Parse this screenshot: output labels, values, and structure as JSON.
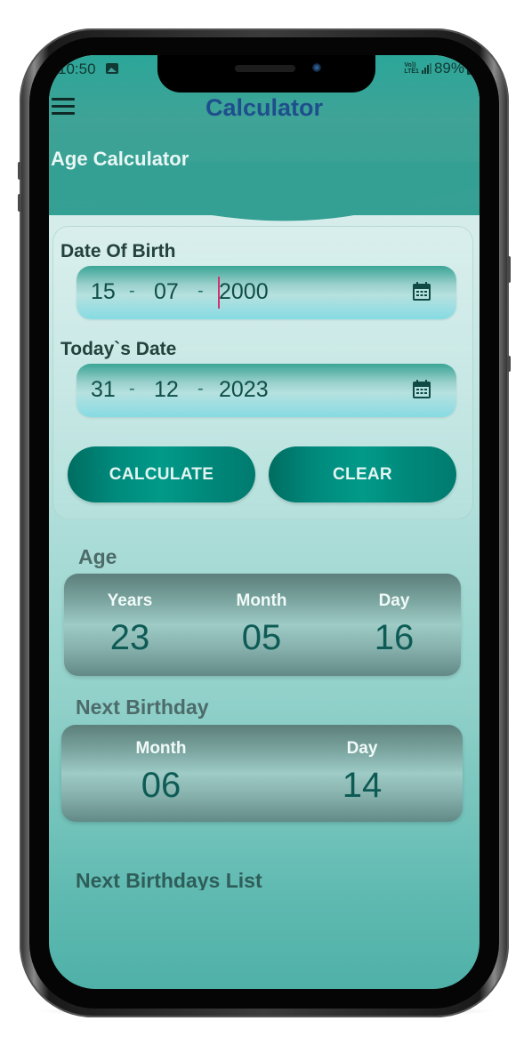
{
  "status_bar": {
    "time": "10:50",
    "network_label": "Vo)) LTE1",
    "battery": "89%"
  },
  "app_bar": {
    "title": "Calculator",
    "menu_icon": "hamburger-menu-icon"
  },
  "header": {
    "section_title": "Age Calculator"
  },
  "form": {
    "dob": {
      "label": "Date Of Birth",
      "day": "15",
      "month": "07",
      "year": "2000",
      "separator": "-",
      "icon": "calendar-icon"
    },
    "today": {
      "label": "Today`s Date",
      "day": "31",
      "month": "12",
      "year": "2023",
      "separator": "-",
      "icon": "calendar-icon"
    },
    "calculate_label": "CALCULATE",
    "clear_label": "CLEAR"
  },
  "age": {
    "title": "Age",
    "columns": [
      {
        "label": "Years",
        "value": "23"
      },
      {
        "label": "Month",
        "value": "05"
      },
      {
        "label": "Day",
        "value": "16"
      }
    ]
  },
  "next_birthday": {
    "title": "Next Birthday",
    "columns": [
      {
        "label": "Month",
        "value": "06"
      },
      {
        "label": "Day",
        "value": "14"
      }
    ]
  },
  "next_birthdays_list": {
    "title": "Next Birthdays List"
  },
  "colors": {
    "header_teal": "#349f93",
    "title_blue": "#1f4e8c",
    "button_teal": "#00897b",
    "value_text": "#0e5b55",
    "caret": "#d23270"
  }
}
